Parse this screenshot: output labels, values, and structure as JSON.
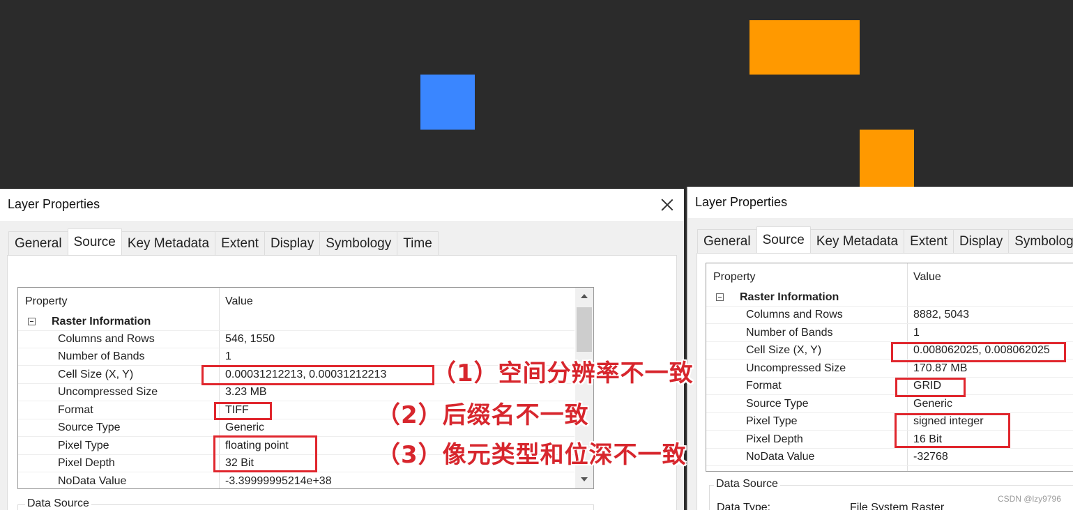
{
  "colors": {
    "blue_square": "#3a86ff",
    "orange_square": "#ff9900",
    "background": "#2b2b2b",
    "annotation": "#d7262d"
  },
  "left": {
    "title": "Layer Properties",
    "tabs": [
      "General",
      "Source",
      "Key Metadata",
      "Extent",
      "Display",
      "Symbology",
      "Time"
    ],
    "active_tab": "Source",
    "header": {
      "property": "Property",
      "value": "Value"
    },
    "group": "Raster Information",
    "rows": [
      {
        "k": "Columns and Rows",
        "v": "546, 1550"
      },
      {
        "k": "Number of Bands",
        "v": "1"
      },
      {
        "k": "Cell Size (X, Y)",
        "v": "0.00031212213, 0.00031212213"
      },
      {
        "k": "Uncompressed Size",
        "v": "3.23 MB"
      },
      {
        "k": "Format",
        "v": "TIFF"
      },
      {
        "k": "Source Type",
        "v": "Generic"
      },
      {
        "k": "Pixel Type",
        "v": "floating point"
      },
      {
        "k": "Pixel Depth",
        "v": "32 Bit"
      },
      {
        "k": "NoData Value",
        "v": "-3.39999995214e+38"
      }
    ],
    "data_source_label": "Data Source"
  },
  "right": {
    "title": "Layer Properties",
    "tabs": [
      "General",
      "Source",
      "Key Metadata",
      "Extent",
      "Display",
      "Symbology"
    ],
    "active_tab": "Source",
    "header": {
      "property": "Property",
      "value": "Value"
    },
    "group": "Raster Information",
    "rows": [
      {
        "k": "Columns and Rows",
        "v": "8882, 5043"
      },
      {
        "k": "Number of Bands",
        "v": "1"
      },
      {
        "k": "Cell Size (X, Y)",
        "v": "0.008062025, 0.008062025"
      },
      {
        "k": "Uncompressed Size",
        "v": "170.87 MB"
      },
      {
        "k": "Format",
        "v": "GRID"
      },
      {
        "k": "Source Type",
        "v": "Generic"
      },
      {
        "k": "Pixel Type",
        "v": "signed integer"
      },
      {
        "k": "Pixel Depth",
        "v": "16 Bit"
      },
      {
        "k": "NoData Value",
        "v": "-32768"
      }
    ],
    "data_source_label": "Data Source",
    "data_type_label": "Data Type:",
    "data_type_value": "File System Raster"
  },
  "annotations": [
    "（1）空间分辨率不一致",
    "（2）后缀名不一致",
    "（3）像元类型和位深不一致"
  ],
  "watermark": "CSDN @lzy9796"
}
